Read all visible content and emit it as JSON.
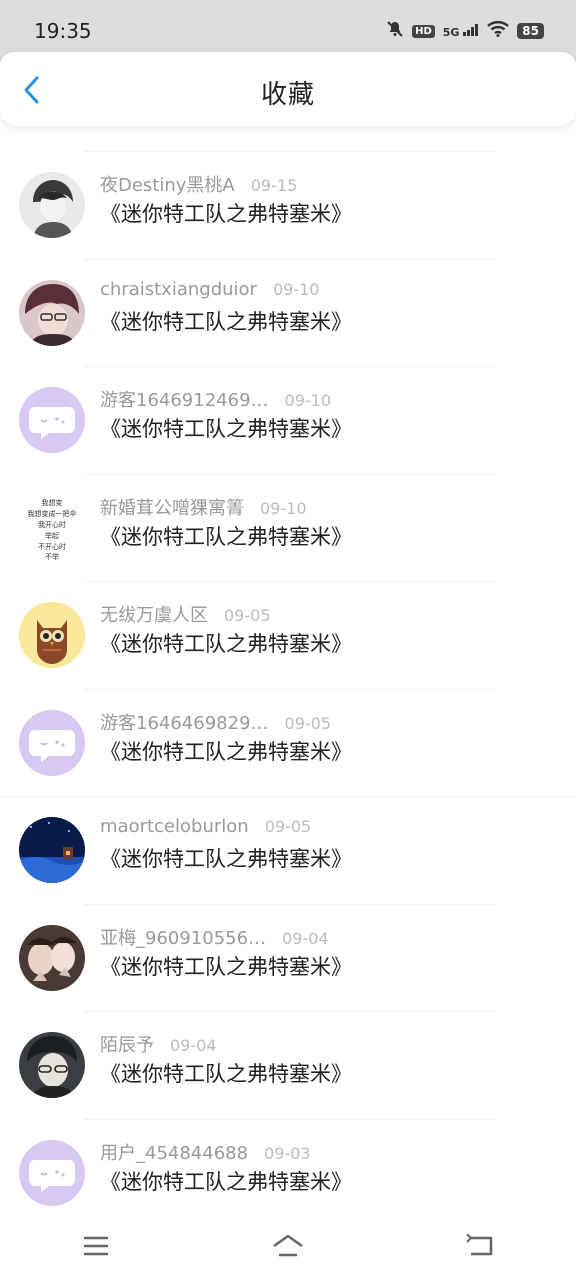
{
  "status_bar": {
    "time": "19:35",
    "hd": "HD",
    "network": "5G",
    "battery": "85",
    "icons": [
      "mute-icon",
      "hd-icon",
      "signal-icon",
      "wifi-icon",
      "battery-icon"
    ]
  },
  "header": {
    "title": "收藏",
    "back_icon": "chevron-left-icon",
    "accent_color": "#2f8ee0"
  },
  "entries": [
    {
      "user": "夜Destiny黑桃A",
      "date": "09-15",
      "title": "《迷你特工队之弗特塞米》",
      "avatar": "sketch-boy"
    },
    {
      "user": "chraistxiangduior",
      "date": "09-10",
      "title": "《迷你特工队之弗特塞米》",
      "avatar": "anime-glasses"
    },
    {
      "user": "游客1646912469…",
      "date": "09-10",
      "title": "《迷你特工队之弗特塞米》",
      "avatar": "chat-bubble"
    },
    {
      "user": "新婚茸公噌猓寓箐",
      "date": "09-10",
      "title": "《迷你特工队之弗特塞米》",
      "avatar": "text-note",
      "avatar_text": [
        "我想变",
        "我想变成一把伞",
        "我开心时",
        "举起",
        "不开心时",
        "不举"
      ]
    },
    {
      "user": "无绂万虞人区",
      "date": "09-05",
      "title": "《迷你特工队之弗特塞米》",
      "avatar": "owl"
    },
    {
      "user": "游客1646469829…",
      "date": "09-05",
      "title": "《迷你特工队之弗特塞米》",
      "avatar": "chat-bubble"
    },
    {
      "user": "maortceloburlon",
      "date": "09-05",
      "title": "《迷你特工队之弗特塞米》",
      "avatar": "night-scene"
    },
    {
      "user": "亚梅_960910556…",
      "date": "09-04",
      "title": "《迷你特工队之弗特塞米》",
      "avatar": "photo-girls"
    },
    {
      "user": "陌辰予",
      "date": "09-04",
      "title": "《迷你特工队之弗特塞米》",
      "avatar": "anime-dark"
    },
    {
      "user": "用户_454844688",
      "date": "09-03",
      "title": "《迷你特工队之弗特塞米》",
      "avatar": "chat-bubble"
    }
  ],
  "nav": {
    "icons": [
      "menu-icon",
      "home-icon",
      "back-icon"
    ]
  }
}
